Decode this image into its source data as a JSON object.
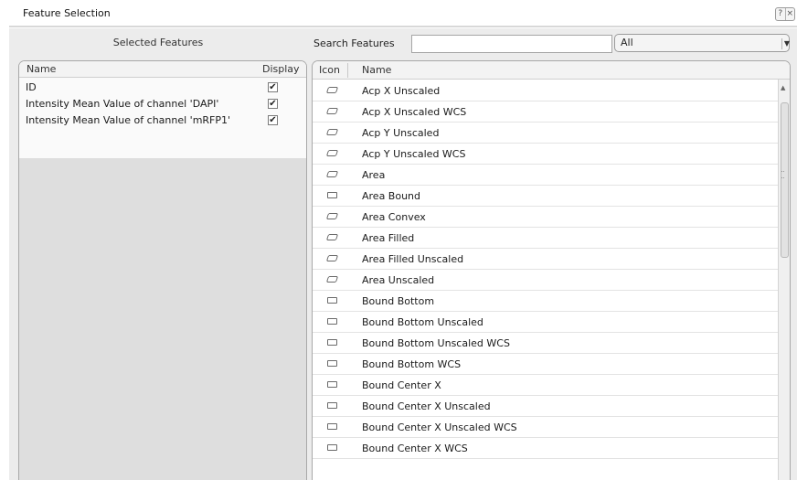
{
  "window": {
    "title": "Feature Selection",
    "help_button": "?",
    "close_button": "×"
  },
  "selected": {
    "header": "Selected Features",
    "columns": {
      "name": "Name",
      "display": "Display"
    },
    "rows": [
      {
        "name": "ID",
        "display": "✔"
      },
      {
        "name": "Intensity Mean Value of channel 'DAPI'",
        "display": "✔"
      },
      {
        "name": "Intensity Mean Value of channel 'mRFP1'",
        "display": "✔"
      }
    ]
  },
  "search": {
    "label": "Search Features",
    "value": "",
    "filter": {
      "value": "All",
      "arrow": "▼"
    }
  },
  "features": {
    "columns": {
      "icon": "Icon",
      "name": "Name"
    },
    "rows": [
      {
        "name": "Acp X Unscaled",
        "icon": "parallelogram-icon"
      },
      {
        "name": "Acp X Unscaled WCS",
        "icon": "parallelogram-icon"
      },
      {
        "name": "Acp Y Unscaled",
        "icon": "parallelogram-icon"
      },
      {
        "name": "Acp Y Unscaled WCS",
        "icon": "parallelogram-icon"
      },
      {
        "name": "Area",
        "icon": "parallelogram-icon"
      },
      {
        "name": "Area Bound",
        "icon": "rectangle-icon"
      },
      {
        "name": "Area Convex",
        "icon": "parallelogram-icon"
      },
      {
        "name": "Area Filled",
        "icon": "parallelogram-icon"
      },
      {
        "name": "Area Filled Unscaled",
        "icon": "parallelogram-icon"
      },
      {
        "name": "Area Unscaled",
        "icon": "parallelogram-icon"
      },
      {
        "name": "Bound Bottom",
        "icon": "rectangle-icon"
      },
      {
        "name": "Bound Bottom Unscaled",
        "icon": "rectangle-icon"
      },
      {
        "name": "Bound Bottom Unscaled WCS",
        "icon": "rectangle-icon"
      },
      {
        "name": "Bound Bottom WCS",
        "icon": "rectangle-icon"
      },
      {
        "name": "Bound Center X",
        "icon": "rectangle-icon"
      },
      {
        "name": "Bound Center X Unscaled",
        "icon": "rectangle-icon"
      },
      {
        "name": "Bound Center X Unscaled WCS",
        "icon": "rectangle-icon"
      },
      {
        "name": "Bound Center X WCS",
        "icon": "rectangle-icon"
      }
    ],
    "scroll_up": "▲"
  }
}
